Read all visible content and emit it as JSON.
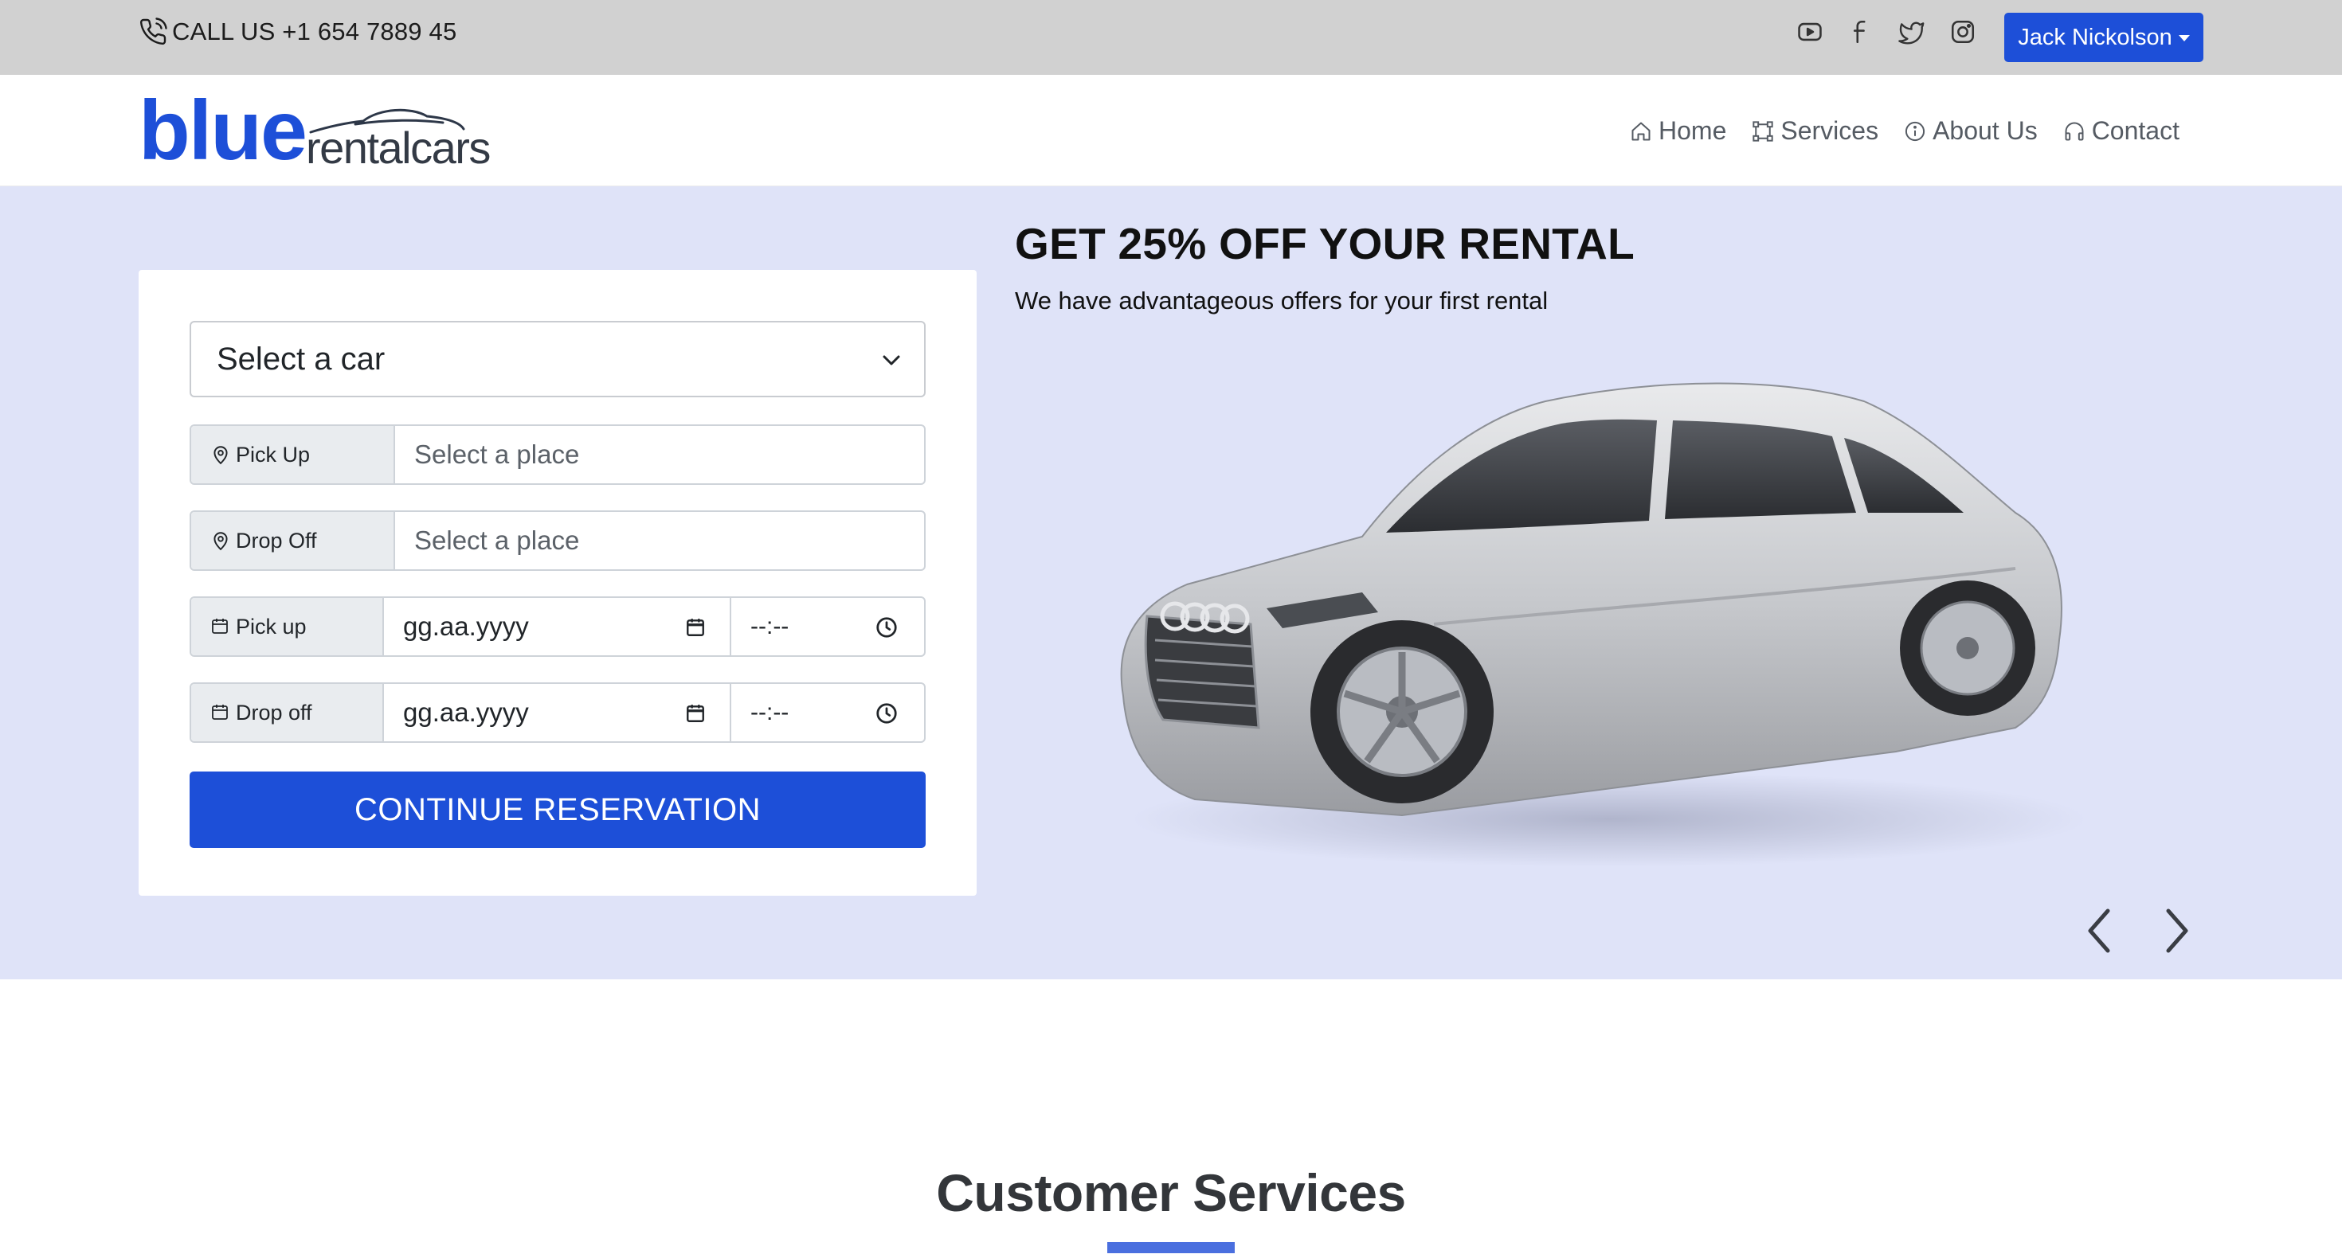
{
  "topbar": {
    "call_text": "CALL US +1 654 7889 45",
    "socials": [
      "youtube-icon",
      "facebook-icon",
      "twitter-icon",
      "instagram-icon"
    ],
    "user_name": "Jack Nickolson"
  },
  "logo": {
    "brand": "blue",
    "tagline": "rentalcars"
  },
  "nav": {
    "items": [
      {
        "label": "Home",
        "icon": "home-icon"
      },
      {
        "label": "Services",
        "icon": "services-icon"
      },
      {
        "label": "About Us",
        "icon": "info-icon"
      },
      {
        "label": "Contact",
        "icon": "headphones-icon"
      }
    ]
  },
  "form": {
    "car_select": "Select a car",
    "pickup_label": "Pick Up",
    "pickup_placeholder": "Select a place",
    "dropoff_label": "Drop Off",
    "dropoff_placeholder": "Select a place",
    "pickup_date_label": "Pick up",
    "pickup_date_value": "gg.aa.yyyy",
    "pickup_time_value": "--:--",
    "dropoff_date_label": "Drop off",
    "dropoff_date_value": "gg.aa.yyyy",
    "dropoff_time_value": "--:--",
    "continue_label": "CONTINUE RESERVATION"
  },
  "promo": {
    "title": "GET 25% OFF YOUR RENTAL",
    "subtitle": "We have advantageous offers for your first rental"
  },
  "section": {
    "title": "Customer Services"
  },
  "colors": {
    "accent": "#1d4fd8",
    "hero_bg": "#dfe3f8",
    "topbar_bg": "#d1d1d1",
    "underline": "#4a6fdf"
  }
}
